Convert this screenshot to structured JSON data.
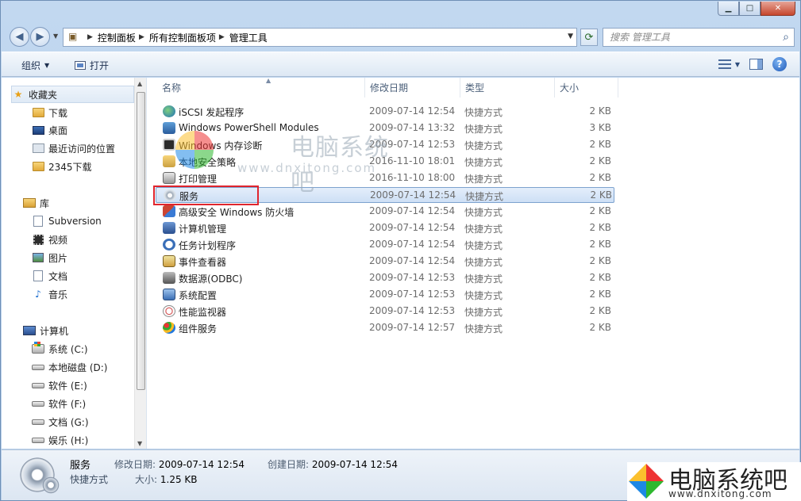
{
  "window": {
    "minimize_symbol": "▁",
    "maximize_symbol": "□",
    "close_symbol": "✕"
  },
  "address_bar": {
    "crumbs": [
      "控制面板",
      "所有控制面板项",
      "管理工具"
    ],
    "separator": "▶",
    "dropdown": "▼"
  },
  "search": {
    "placeholder": "搜索 管理工具"
  },
  "toolbar": {
    "organize": "组织",
    "open": "打开",
    "dropdown": "▼",
    "help": "?"
  },
  "nav_pane": {
    "favorites": {
      "label": "收藏夹",
      "items": [
        "下载",
        "桌面",
        "最近访问的位置",
        "2345下载"
      ]
    },
    "libraries": {
      "label": "库",
      "items": [
        "Subversion",
        "视频",
        "图片",
        "文档",
        "音乐"
      ]
    },
    "computer": {
      "label": "计算机",
      "items": [
        "系统 (C:)",
        "本地磁盘 (D:)",
        "软件 (E:)",
        "软件 (F:)",
        "文档 (G:)",
        "娱乐 (H:)"
      ]
    }
  },
  "columns": {
    "name": "名称",
    "modified": "修改日期",
    "type": "类型",
    "size": "大小"
  },
  "files": [
    {
      "name": "iSCSI 发起程序",
      "date": "2009-07-14 12:54",
      "type": "快捷方式",
      "size": "2 KB",
      "icon": "iscsi-icon"
    },
    {
      "name": "Windows PowerShell Modules",
      "date": "2009-07-14 13:32",
      "type": "快捷方式",
      "size": "3 KB",
      "icon": "powershell-icon"
    },
    {
      "name": "Windows 内存诊断",
      "date": "2009-07-14 12:53",
      "type": "快捷方式",
      "size": "2 KB",
      "icon": "memory-diagnostic-icon"
    },
    {
      "name": "本地安全策略",
      "date": "2016-11-10 18:01",
      "type": "快捷方式",
      "size": "2 KB",
      "icon": "security-policy-icon"
    },
    {
      "name": "打印管理",
      "date": "2016-11-10 18:00",
      "type": "快捷方式",
      "size": "2 KB",
      "icon": "print-management-icon"
    },
    {
      "name": "服务",
      "date": "2009-07-14 12:54",
      "type": "快捷方式",
      "size": "2 KB",
      "icon": "services-icon",
      "selected": true
    },
    {
      "name": "高级安全 Windows 防火墙",
      "date": "2009-07-14 12:54",
      "type": "快捷方式",
      "size": "2 KB",
      "icon": "firewall-icon"
    },
    {
      "name": "计算机管理",
      "date": "2009-07-14 12:54",
      "type": "快捷方式",
      "size": "2 KB",
      "icon": "computer-management-icon"
    },
    {
      "name": "任务计划程序",
      "date": "2009-07-14 12:54",
      "type": "快捷方式",
      "size": "2 KB",
      "icon": "task-scheduler-icon"
    },
    {
      "name": "事件查看器",
      "date": "2009-07-14 12:54",
      "type": "快捷方式",
      "size": "2 KB",
      "icon": "event-viewer-icon"
    },
    {
      "name": "数据源(ODBC)",
      "date": "2009-07-14 12:53",
      "type": "快捷方式",
      "size": "2 KB",
      "icon": "odbc-icon"
    },
    {
      "name": "系统配置",
      "date": "2009-07-14 12:53",
      "type": "快捷方式",
      "size": "2 KB",
      "icon": "system-config-icon"
    },
    {
      "name": "性能监视器",
      "date": "2009-07-14 12:53",
      "type": "快捷方式",
      "size": "2 KB",
      "icon": "performance-monitor-icon"
    },
    {
      "name": "组件服务",
      "date": "2009-07-14 12:57",
      "type": "快捷方式",
      "size": "2 KB",
      "icon": "component-services-icon"
    }
  ],
  "details": {
    "name": "服务",
    "type": "快捷方式",
    "modified_label": "修改日期:",
    "modified_value": "2009-07-14 12:54",
    "created_label": "创建日期:",
    "created_value": "2009-07-14 12:54",
    "size_label": "大小:",
    "size_value": "1.25 KB"
  },
  "watermark": {
    "title": "电脑系统吧",
    "url": "www.dnxitong.com"
  },
  "colors": {
    "selection": "#cddff5",
    "highlight_box": "#e0252d"
  }
}
